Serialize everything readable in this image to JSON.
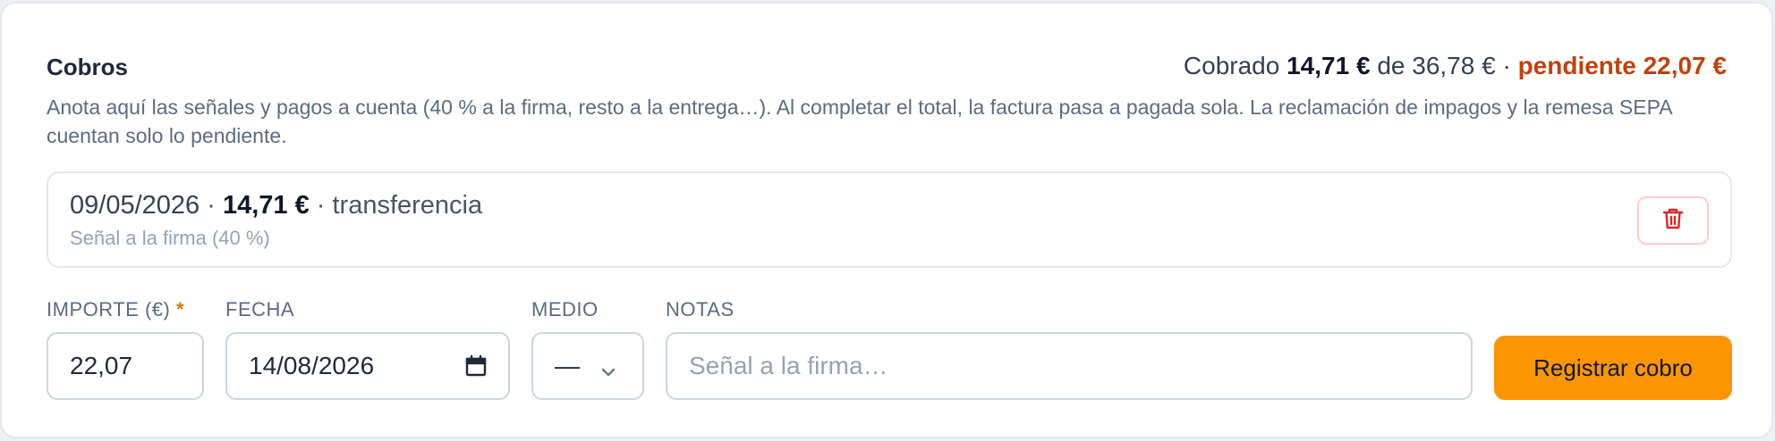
{
  "section": {
    "title": "Cobros",
    "summary": {
      "collected_label": "Cobrado",
      "collected_amount": "14,71 €",
      "of_label": "de",
      "total_amount": "36,78 €",
      "separator": "·",
      "pending_text": "pendiente 22,07 €"
    },
    "description": "Anota aquí las señales y pagos a cuenta (40 % a la firma, resto a la entrega…). Al completar el total, la factura pasa a pagada sola. La reclamación de impagos y la remesa SEPA cuentan solo lo pendiente."
  },
  "payments": [
    {
      "date": "09/05/2026",
      "amount": "14,71 €",
      "method": "transferencia",
      "note": "Señal a la firma (40 %)"
    }
  ],
  "form": {
    "amount_label": "IMPORTE (€)",
    "required_mark": "*",
    "amount_value": "22,07",
    "date_label": "FECHA",
    "date_value": "14/08/2026",
    "method_label": "MEDIO",
    "method_value": "—",
    "notes_label": "NOTAS",
    "notes_placeholder": "Señal a la firma…",
    "submit_label": "Registrar cobro"
  },
  "icons": {
    "delete": "trash-icon",
    "calendar": "calendar-icon",
    "dropdown": "chevron-down-icon"
  },
  "colors": {
    "pending": "#c2410c",
    "accent": "#fb9504",
    "delete": "#dc2626",
    "required": "#d97706"
  }
}
